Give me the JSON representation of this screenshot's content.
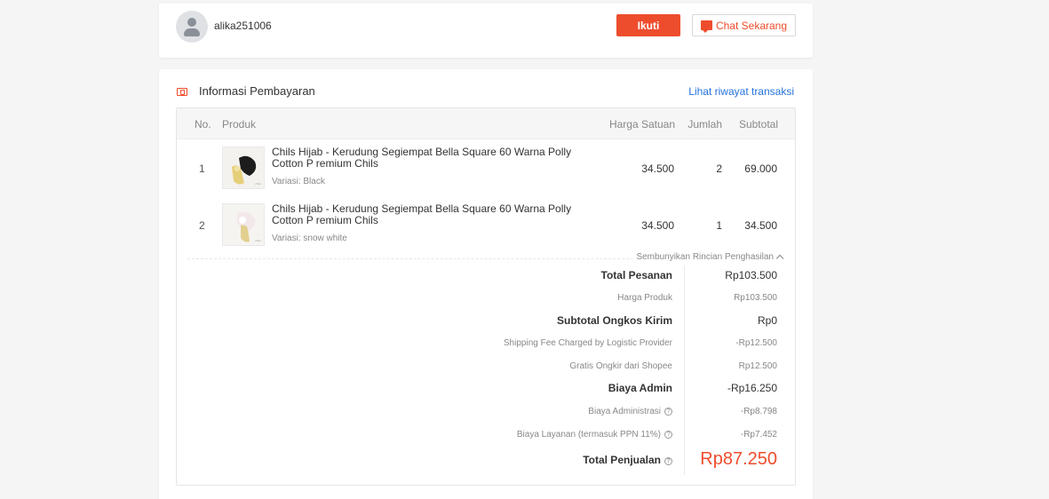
{
  "seller": {
    "username": "alika251006",
    "follow_label": "Ikuti",
    "chat_label": "Chat Sekarang"
  },
  "payment": {
    "title": "Informasi Pembayaran",
    "history_link": "Lihat riwayat transaksi",
    "columns": {
      "no": "No.",
      "product": "Produk",
      "unit_price": "Harga Satuan",
      "qty": "Jumlah",
      "subtotal": "Subtotal"
    },
    "items": [
      {
        "no": "1",
        "name": "Chils Hijab - Kerudung Segiempat Bella Square 60 Warna Polly Cotton P remium Chils",
        "variant": "Variasi: Black",
        "unit_price": "34.500",
        "qty": "2",
        "subtotal": "69.000"
      },
      {
        "no": "2",
        "name": "Chils Hijab - Kerudung Segiempat Bella Square 60 Warna Polly Cotton P remium Chils",
        "variant": "Variasi: snow white",
        "unit_price": "34.500",
        "qty": "1",
        "subtotal": "34.500"
      }
    ],
    "toggle_label": "Sembunyikan Rincian Penghasilan",
    "summary": {
      "total_order_label": "Total Pesanan",
      "total_order_value": "Rp103.500",
      "product_price_label": "Harga Produk",
      "product_price_value": "Rp103.500",
      "shipping_subtotal_label": "Subtotal Ongkos Kirim",
      "shipping_subtotal_value": "Rp0",
      "shipping_charged_label": "Shipping Fee Charged by Logistic Provider",
      "shipping_charged_value": "-Rp12.500",
      "free_shipping_label": "Gratis Ongkir dari Shopee",
      "free_shipping_value": "Rp12.500",
      "admin_fee_label": "Biaya Admin",
      "admin_fee_value": "-Rp16.250",
      "administration_label": "Biaya Administrasi",
      "administration_value": "-Rp8.798",
      "service_fee_label": "Biaya Layanan (termasuk PPN 11%)",
      "service_fee_value": "-Rp7.452",
      "total_sales_label": "Total Penjualan",
      "total_sales_value": "Rp87.250"
    }
  },
  "colors": {
    "accent": "#ee4d2d",
    "link": "#2673dd",
    "background": "#f5f5f5"
  },
  "icons": [
    "user-avatar-icon",
    "chat-icon",
    "payment-info-icon",
    "chevron-up-icon",
    "help-icon"
  ]
}
